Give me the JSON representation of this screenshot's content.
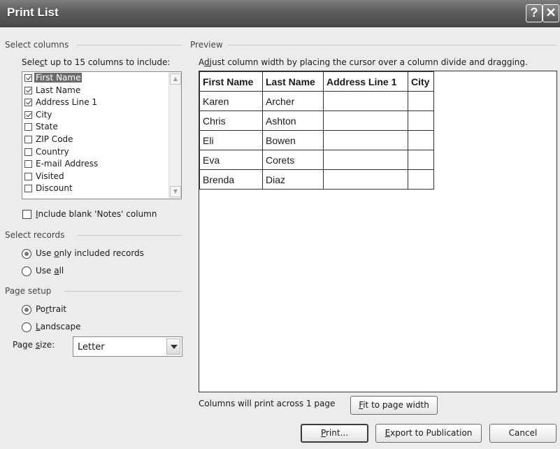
{
  "window": {
    "title": "Print List",
    "help_glyph": "?",
    "close_glyph": "✕"
  },
  "columns_group": {
    "label": "Select columns",
    "instruction": "Select up to 15 columns to include:",
    "items": [
      {
        "label": "First Name",
        "checked": true
      },
      {
        "label": "Last Name",
        "checked": true
      },
      {
        "label": "Address Line 1",
        "checked": true
      },
      {
        "label": "City",
        "checked": true
      },
      {
        "label": "State",
        "checked": false
      },
      {
        "label": "ZIP Code",
        "checked": false
      },
      {
        "label": "Country",
        "checked": false
      },
      {
        "label": "E-mail Address",
        "checked": false
      },
      {
        "label": "Visited",
        "checked": false
      },
      {
        "label": "Discount",
        "checked": false
      }
    ],
    "blank_notes_label": "Include blank 'Notes' column",
    "blank_notes_checked": false
  },
  "records_group": {
    "label": "Select records",
    "options": [
      "Use only included records",
      "Use all"
    ],
    "selected": 0
  },
  "page_setup": {
    "label": "Page setup",
    "orientation_options": [
      "Portrait",
      "Landscape"
    ],
    "orientation_selected": 0,
    "page_size_label": "Page size:",
    "page_size_value": "Letter"
  },
  "preview": {
    "label": "Preview",
    "instruction": "Adjust column width by placing the cursor over a column divide and dragging.",
    "headers": [
      "First Name",
      "Last Name",
      "Address Line 1",
      "City"
    ],
    "rows": [
      [
        "Karen",
        "Archer",
        "",
        ""
      ],
      [
        "Chris",
        "Ashton",
        "",
        ""
      ],
      [
        "Eli",
        "Bowen",
        "",
        ""
      ],
      [
        "Eva",
        "Corets",
        "",
        ""
      ],
      [
        "Brenda",
        "Diaz",
        "",
        ""
      ]
    ],
    "pages_note": "Columns will print across 1 page",
    "fit_button": "Fit to page width"
  },
  "footer": {
    "print_button": "Print...",
    "export_button": "Export to Publication",
    "cancel_button": "Cancel"
  }
}
